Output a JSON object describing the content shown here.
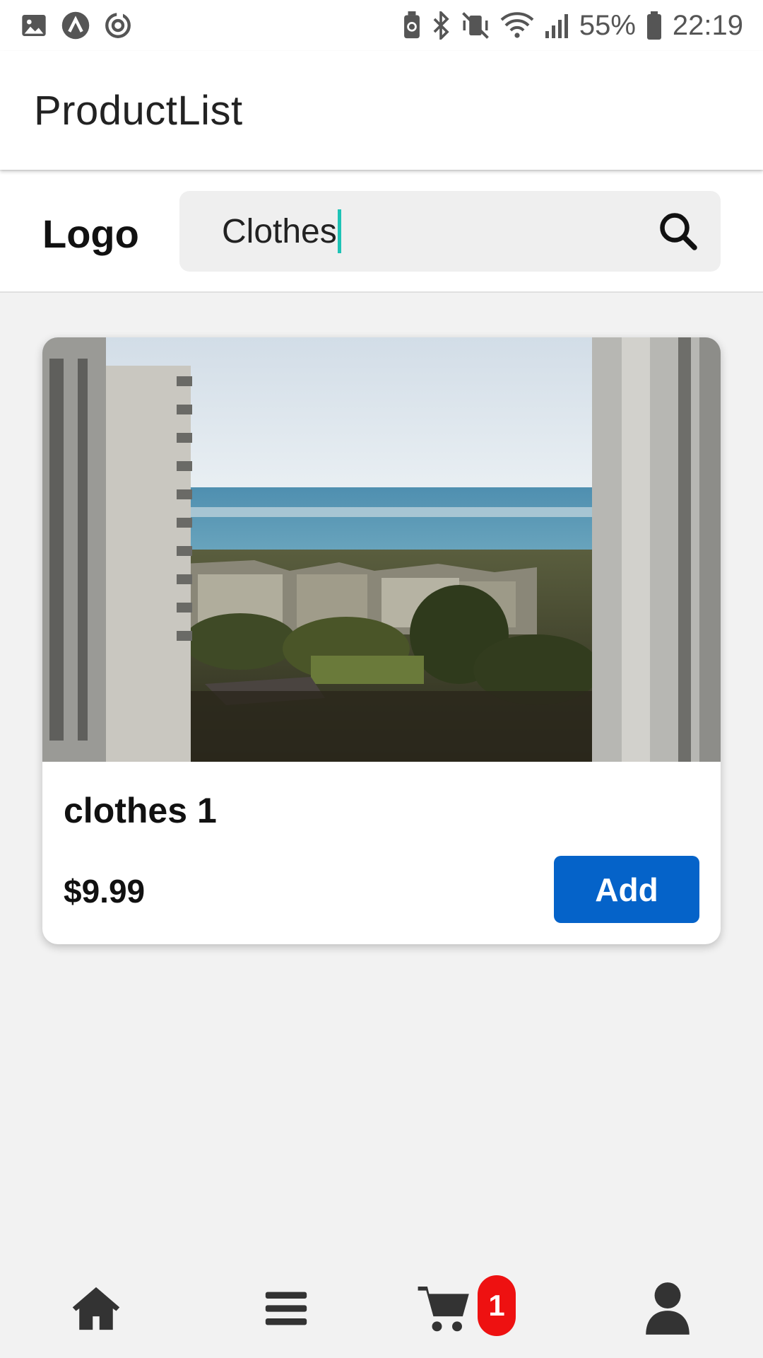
{
  "status_bar": {
    "left_icons": [
      "image-icon",
      "app-a-icon",
      "sync-icon"
    ],
    "right_icons": [
      "battery-saver-icon",
      "bluetooth-icon",
      "vibrate-mute-icon",
      "wifi-icon",
      "signal-icon",
      "battery-icon"
    ],
    "battery": "55%",
    "time": "22:19"
  },
  "app_bar": {
    "title": "ProductList"
  },
  "header": {
    "logo": "Logo",
    "search": {
      "value": "Clothes",
      "icon": "search-icon"
    }
  },
  "products": [
    {
      "name": "clothes 1",
      "price": "$9.99",
      "add_label": "Add",
      "image": "city-seaview-photo"
    }
  ],
  "bottom_nav": {
    "items": [
      "home-icon",
      "menu-icon",
      "cart-icon",
      "user-icon"
    ],
    "cart_count": "1"
  },
  "colors": {
    "accent": "#0563c9",
    "badge": "#ee1111",
    "caret": "#1ec3b6",
    "background": "#f2f2f2"
  }
}
